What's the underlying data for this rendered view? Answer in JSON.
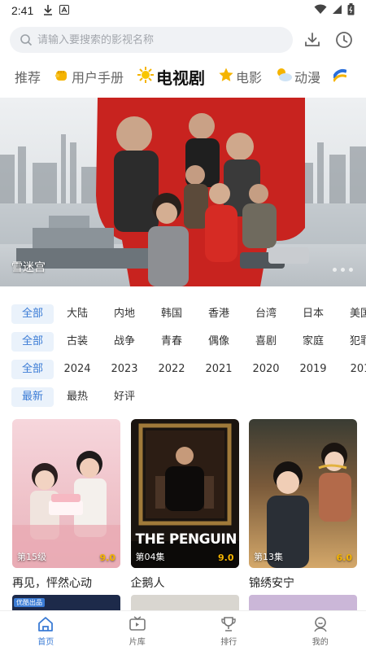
{
  "status_bar": {
    "time": "2:41"
  },
  "search": {
    "placeholder": "请输入要搜索的影视名称"
  },
  "tabs": [
    {
      "label": "推荐",
      "icon": ""
    },
    {
      "label": "用户手册",
      "icon": "fist-emoji"
    },
    {
      "label": "电视剧",
      "icon": "sun-emoji"
    },
    {
      "label": "电影",
      "icon": "star-emoji"
    },
    {
      "label": "动漫",
      "icon": "cloud-sun-emoji"
    }
  ],
  "banner": {
    "caption": "雪迷宫"
  },
  "filters": {
    "region": [
      "全部",
      "大陆",
      "内地",
      "韩国",
      "香港",
      "台湾",
      "日本",
      "美国"
    ],
    "genre": [
      "全部",
      "古装",
      "战争",
      "青春",
      "偶像",
      "喜剧",
      "家庭",
      "犯罪"
    ],
    "year": [
      "全部",
      "2024",
      "2023",
      "2022",
      "2021",
      "2020",
      "2019",
      "201"
    ],
    "sort": [
      "最新",
      "最热",
      "好评"
    ]
  },
  "cards": [
    {
      "title": "再见，怦然心动",
      "episode": "第15级",
      "score": "9.0"
    },
    {
      "title": "企鹅人",
      "episode": "第04集",
      "score": "9.0"
    },
    {
      "title": "锦绣安宁",
      "episode": "第13集",
      "score": "6.0"
    }
  ],
  "peek": {
    "tag": "优酷出品"
  },
  "bottom_nav": [
    {
      "label": "首页"
    },
    {
      "label": "片库"
    },
    {
      "label": "排行"
    },
    {
      "label": "我的"
    }
  ],
  "colors": {
    "accent": "#3a7bd5",
    "chip_bg": "#eaf2fb",
    "search_bg": "#f0f2f5"
  }
}
